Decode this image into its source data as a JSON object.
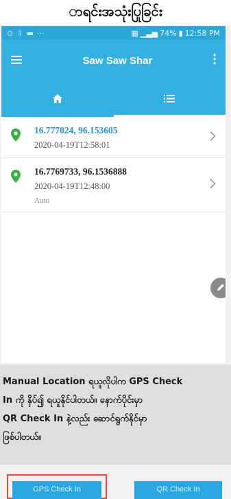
{
  "page": {
    "heading": "ာရင်းအသုံးပြုခြင်း"
  },
  "statusbar": {
    "battery": "74%",
    "time": "12:58 PM"
  },
  "appbar": {
    "title": "Saw Saw Shar"
  },
  "list": {
    "items": [
      {
        "coords": "16.777024, 96.153605",
        "timestamp": "2020-04-19T12:58:01",
        "tag": ""
      },
      {
        "coords": "16.7769733, 96.1536888",
        "timestamp": "2020-04-19T12:48:00",
        "tag": "Auto"
      }
    ]
  },
  "description": {
    "lines": [
      "Manual Location ရယူလိုပါက GPS Check",
      "In ကို နှိပ်၍ ရယူနိုင်ပါတယ်။ နောက်ပိုင်းမှာ",
      "QR Check In နဲ့လည်း ဆောင်ရွက်နိုင်မှာ",
      "ဖြစ်ပါတယ်။"
    ]
  },
  "buttons": {
    "gps": "GPS Check In",
    "qr": "QR Check In"
  },
  "colors": {
    "primary": "#33b1e3",
    "statusbar": "#2aa7d8",
    "pin": "#3cb043",
    "link": "#2a8fd6",
    "highlight": "#ef4a3a"
  },
  "icons": [
    "menu-icon",
    "more-vert-icon",
    "home-icon",
    "list-icon",
    "location-pin-icon",
    "chevron-right-icon",
    "edit-icon"
  ]
}
